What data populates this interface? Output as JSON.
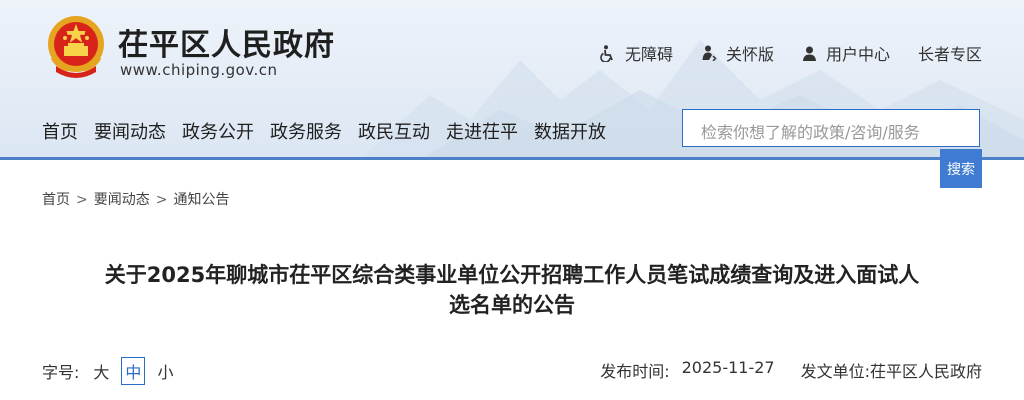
{
  "site": {
    "title": "茌平区人民政府",
    "domain": "www.chiping.gov.cn"
  },
  "tools": [
    {
      "icon": "wheelchair-icon",
      "label": "无障碍"
    },
    {
      "icon": "care-mode-icon",
      "label": "关怀版"
    },
    {
      "icon": "user-icon",
      "label": "用户中心"
    },
    {
      "icon": "",
      "label": "长者专区"
    }
  ],
  "nav": [
    "首页",
    "要闻动态",
    "政务公开",
    "政务服务",
    "政民互动",
    "走进茌平",
    "数据开放"
  ],
  "search": {
    "placeholder": "检索你想了解的政策/咨询/服务",
    "button": "搜索"
  },
  "breadcrumb": [
    "首页",
    "要闻动态",
    "通知公告"
  ],
  "article": {
    "title_line1": "关于2025年聊城市茌平区综合类事业单位公开招聘工作人员笔试成绩查询及进入面试人",
    "title_line2": "选名单的公告",
    "font_label": "字号:",
    "font_sizes": [
      "大",
      "中",
      "小"
    ],
    "publish_label": "发布时间:",
    "publish_date": "2025-11-27",
    "issuer_label": "发文单位:",
    "issuer": "茌平区人民政府"
  },
  "colors": {
    "accent": "#3e7bd1",
    "header_bg": "#e4ecf6"
  }
}
